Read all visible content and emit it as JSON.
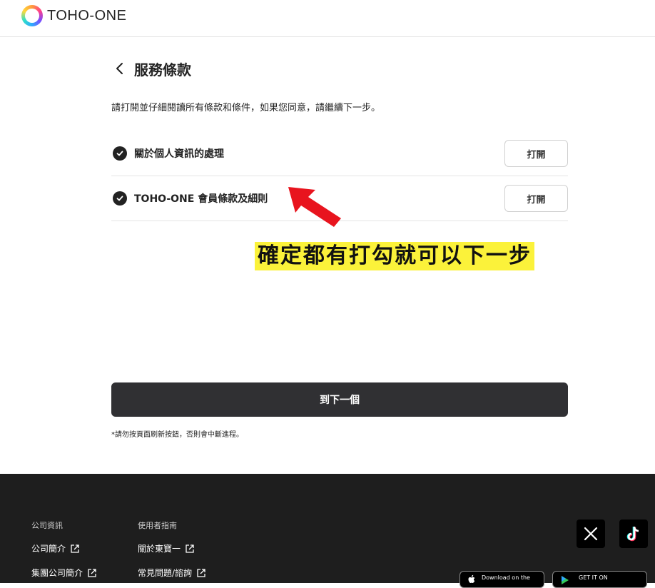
{
  "header": {
    "logo_text": "TOHO-ONE"
  },
  "page": {
    "title": "服務條款",
    "description": "請打開並仔細閱讀所有條款和條件，如果您同意，請繼續下一步。"
  },
  "terms": [
    {
      "label": "關於個人資訊的處理",
      "button": "打開"
    },
    {
      "label": "TOHO-ONE 會員條款及細則",
      "button": "打開"
    }
  ],
  "annotation": {
    "text": "確定都有打勾就可以下一步",
    "highlight_color": "#fbf23a",
    "arrow_color": "#e8141e"
  },
  "actions": {
    "next_label": "到下一個",
    "note": "*請勿按頁面刷新按鈕，否則會中斷進程。"
  },
  "footer": {
    "col1": {
      "title": "公司資訊",
      "links": [
        "公司簡介",
        "集團公司簡介"
      ]
    },
    "col2": {
      "title": "使用者指南",
      "links": [
        "關於東寶一",
        "常見問題/諮詢"
      ]
    },
    "social": [
      "x-icon",
      "tiktok-icon"
    ],
    "stores": {
      "apple": "Download on the",
      "google": "GET IT ON"
    }
  }
}
